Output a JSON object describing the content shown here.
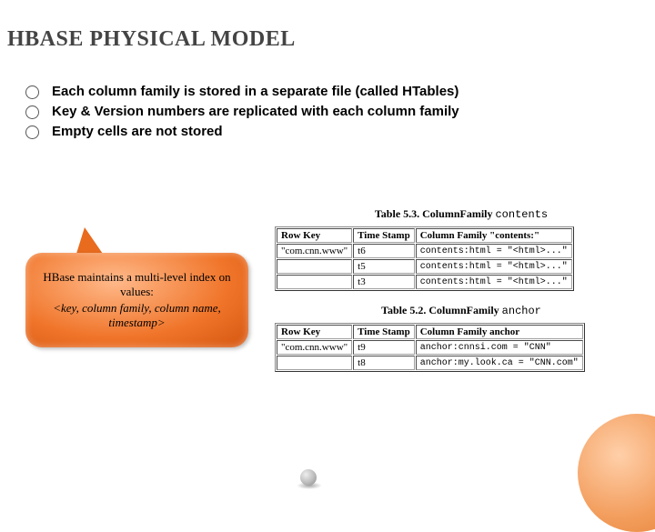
{
  "title": "HBASE PHYSICAL MODEL",
  "bullets": [
    "Each column family is stored in a separate file (called HTables)",
    "Key & Version numbers are replicated with each column family",
    "Empty cells are not stored"
  ],
  "bubble": {
    "line1": "HBase maintains a multi-level index on values:",
    "line2": "<key, column family, column name, timestamp>"
  },
  "table1": {
    "caption_prefix": "Table 5.3. ColumnFamily ",
    "caption_mono": "contents",
    "headers": [
      "Row Key",
      "Time Stamp",
      "Column Family \"contents:\""
    ],
    "rows": [
      [
        "\"com.cnn.www\"",
        "t6",
        "contents:html = \"<html>...\""
      ],
      [
        "",
        "t5",
        "contents:html = \"<html>...\""
      ],
      [
        "",
        "t3",
        "contents:html = \"<html>...\""
      ]
    ]
  },
  "table2": {
    "caption_prefix": "Table 5.2. ColumnFamily ",
    "caption_mono": "anchor",
    "headers": [
      "Row Key",
      "Time Stamp",
      "Column Family anchor"
    ],
    "rows": [
      [
        "\"com.cnn.www\"",
        "t9",
        "anchor:cnnsi.com = \"CNN\""
      ],
      [
        "",
        "t8",
        "anchor:my.look.ca = \"CNN.com\""
      ]
    ]
  },
  "chart_data": {
    "type": "table",
    "tables": [
      {
        "title": "Table 5.3. ColumnFamily contents",
        "columns": [
          "Row Key",
          "Time Stamp",
          "Column Family \"contents:\""
        ],
        "rows": [
          [
            "\"com.cnn.www\"",
            "t6",
            "contents:html = \"<html>...\""
          ],
          [
            "",
            "t5",
            "contents:html = \"<html>...\""
          ],
          [
            "",
            "t3",
            "contents:html = \"<html>...\""
          ]
        ]
      },
      {
        "title": "Table 5.2. ColumnFamily anchor",
        "columns": [
          "Row Key",
          "Time Stamp",
          "Column Family anchor"
        ],
        "rows": [
          [
            "\"com.cnn.www\"",
            "t9",
            "anchor:cnnsi.com = \"CNN\""
          ],
          [
            "",
            "t8",
            "anchor:my.look.ca = \"CNN.com\""
          ]
        ]
      }
    ]
  }
}
